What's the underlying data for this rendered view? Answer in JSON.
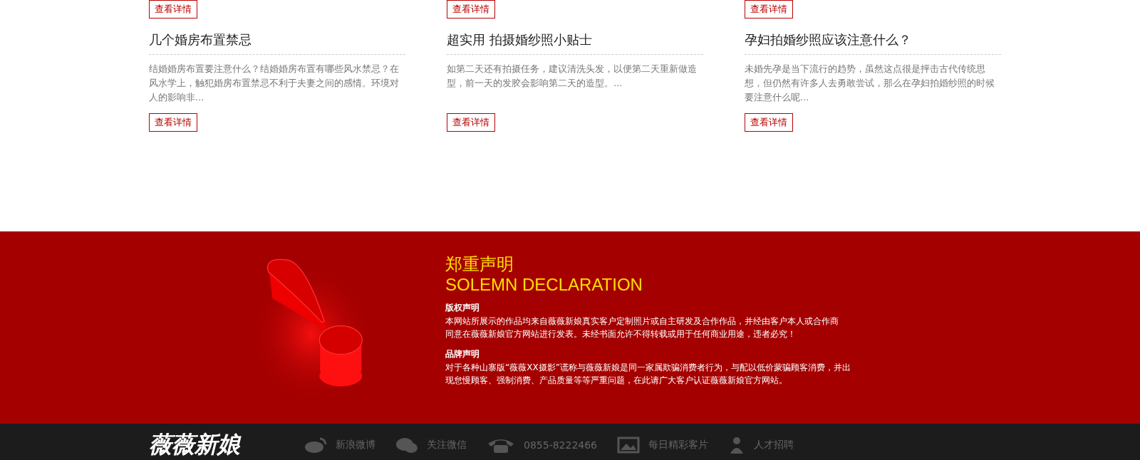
{
  "top_buttons": [
    "查看详情",
    "查看详情",
    "查看详情"
  ],
  "articles": [
    {
      "title": "几个婚房布置禁忌",
      "summary": "结婚婚房布置要注意什么？结婚婚房布置有哪些风水禁忌？在风水学上，触犯婚房布置禁忌不利于夫妻之间的感情。环境对人的影响非...",
      "button": "查看详情"
    },
    {
      "title": "超实用 拍摄婚纱照小贴士",
      "summary": "如第二天还有拍摄任务，建议清洗头发，以便第二天重新做造型，前一天的发胶会影响第二天的造型。...",
      "button": "查看详情"
    },
    {
      "title": "孕妇拍婚纱照应该注意什么？",
      "summary": "未婚先孕是当下流行的趋势，虽然这点很是抨击古代传统思想，但仍然有许多人去勇敢尝试，那么在孕妇拍婚纱照的时候要注意什么呢...",
      "button": "查看详情"
    }
  ],
  "declaration": {
    "title": "郑重声明",
    "subtitle": "SOLEMN DECLARATION",
    "sections": [
      {
        "heading": "版权声明",
        "lines": [
          "本网站所展示的作品均来自薇薇新娘真实客户定制照片或自主研发及合作作品，并经由客户本人或合作商",
          "同意在薇薇新娘官方网站进行发表。未经书面允许不得转载或用于任何商业用途，违者必究！"
        ]
      },
      {
        "heading": "品牌声明",
        "lines": [
          "对于各种山寨版“薇薇XX摄影”谎称与薇薇新娘是同一家属欺骗消费者行为，与配以低价蒙骗顾客消费，并出",
          "现怠慢顾客、强制消费、产品质量等等严重问题，在此请广大客户认证薇薇新娘官方网站。"
        ]
      }
    ]
  },
  "footer": {
    "logo": "薇薇新娘",
    "links": [
      {
        "kind": "weibo",
        "label": "新浪微博"
      },
      {
        "kind": "wechat",
        "label": "关注微信"
      },
      {
        "kind": "phone",
        "label": "0855-8222466"
      },
      {
        "kind": "photo",
        "label": "每日精彩客片"
      },
      {
        "kind": "person",
        "label": "人才招聘"
      }
    ]
  }
}
